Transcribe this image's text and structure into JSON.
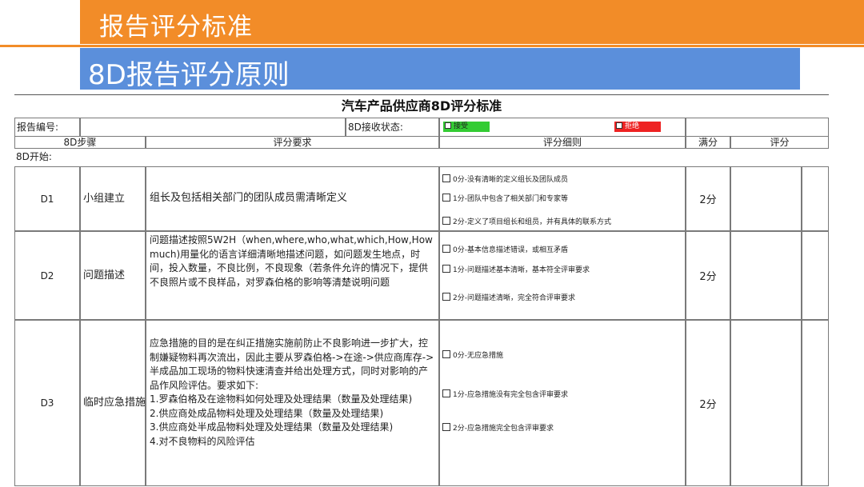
{
  "header": {
    "section_title": "报告评分标准",
    "subtitle": "8D报告评分原则"
  },
  "sheet": {
    "title": "汽车产品供应商8D评分标准",
    "report_no_label": "报告编号:",
    "status_label": "8D接收状态:",
    "accept_label": "接受",
    "reject_label": "拒绝",
    "accept_color": "#33cc33",
    "reject_color": "#ee2222",
    "columns": [
      "8D步骤",
      "评分要求",
      "评分细则",
      "满分",
      "评分"
    ],
    "start_label": "8D开始:",
    "rows": [
      {
        "code": "D1",
        "name": "小组建立",
        "requirement": "组长及包括相关部门的团队成员需清晰定义",
        "criteria": [
          "0分-没有清晰的定义组长及团队成员",
          "1分-团队中包含了相关部门和专家等",
          "2分-定义了项目组长和组员，并有具体的联系方式"
        ],
        "full_score": "2分"
      },
      {
        "code": "D2",
        "name": "问题描述",
        "requirement": "问题描述按照5W2H（when,where,who,what,which,How,How much)用量化的语言详细清晰地描述问题，如问题发生地点，时间，投入数量，不良比例，不良现象（若条件允许的情况下，提供不良照片或不良样品，对罗森伯格的影响等清楚说明问题",
        "criteria": [
          "0分-基本信息描述错误，或相互矛盾",
          "1分-问题描述基本清晰，基本符全评审要求",
          "2分-问题描述清晰，完全符合评审要求"
        ],
        "full_score": "2分"
      },
      {
        "code": "D3",
        "name": "临时应急措施",
        "requirement_lines": [
          "应急措施的目的是在纠正措施实施前防止不良影响进一步扩大，控制嫌疑物料再次流出，因此主要从罗森伯格->在途->供应商库存->半成品加工现场的物料快速清查并给出处理方式，同时对影响的产品作风险评估。要求如下:",
          "1.罗森伯格及在途物料如何处理及处理结果（数量及处理结果)",
          "2.供应商处成品物料处理及处理结果（数量及处理结果)",
          "3.供应商处半成品物料处理及处理结果（数量及处理结果)",
          "4.对不良物料的风险评估"
        ],
        "criteria": [
          "0分-无应急措施",
          "1分-应急措施没有完全包含评审要求",
          "2分-应急措施完全包含评审要求"
        ],
        "full_score": "2分"
      }
    ]
  }
}
